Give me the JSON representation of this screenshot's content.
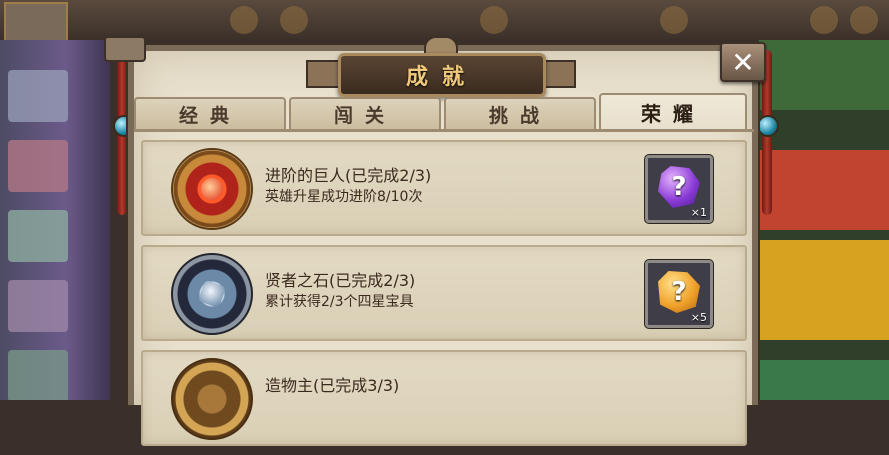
{
  "window": {
    "title": "成就",
    "close_label": "✕"
  },
  "tabs": [
    {
      "label": "经典",
      "active": false
    },
    {
      "label": "闯关",
      "active": false
    },
    {
      "label": "挑战",
      "active": false
    },
    {
      "label": "荣耀",
      "active": true
    }
  ],
  "achievements": [
    {
      "title": "进阶的巨人",
      "status": "(已完成2/3)",
      "description": "英雄升星成功进阶8/10次",
      "medal_icon": "fire-medal-icon",
      "reward_icon": "purple-mystery-gem-icon",
      "reward_qty": "×1"
    },
    {
      "title": "贤者之石",
      "status": "(已完成2/3)",
      "description": "累计获得2/3个四星宝具",
      "medal_icon": "stone-medal-icon",
      "reward_icon": "gold-mystery-gem-icon",
      "reward_qty": "×5"
    },
    {
      "title": "造物主",
      "status": "(已完成3/3)",
      "description": "",
      "medal_icon": "gold-medal-icon"
    }
  ],
  "icons": {
    "reward_symbol": "?"
  },
  "colors": {
    "accent_gold": "#f0c97a",
    "text_dark": "#3b2a1e",
    "panel_bg": "#e8e0cc"
  }
}
